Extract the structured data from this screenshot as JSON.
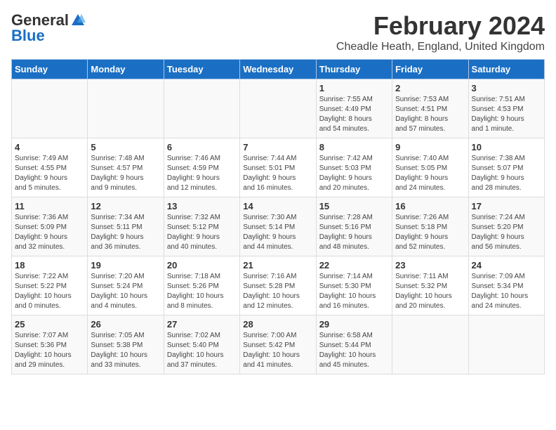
{
  "logo": {
    "general": "General",
    "blue": "Blue"
  },
  "header": {
    "month": "February 2024",
    "location": "Cheadle Heath, England, United Kingdom"
  },
  "weekdays": [
    "Sunday",
    "Monday",
    "Tuesday",
    "Wednesday",
    "Thursday",
    "Friday",
    "Saturday"
  ],
  "weeks": [
    [
      {
        "day": "",
        "info": ""
      },
      {
        "day": "",
        "info": ""
      },
      {
        "day": "",
        "info": ""
      },
      {
        "day": "",
        "info": ""
      },
      {
        "day": "1",
        "info": "Sunrise: 7:55 AM\nSunset: 4:49 PM\nDaylight: 8 hours\nand 54 minutes."
      },
      {
        "day": "2",
        "info": "Sunrise: 7:53 AM\nSunset: 4:51 PM\nDaylight: 8 hours\nand 57 minutes."
      },
      {
        "day": "3",
        "info": "Sunrise: 7:51 AM\nSunset: 4:53 PM\nDaylight: 9 hours\nand 1 minute."
      }
    ],
    [
      {
        "day": "4",
        "info": "Sunrise: 7:49 AM\nSunset: 4:55 PM\nDaylight: 9 hours\nand 5 minutes."
      },
      {
        "day": "5",
        "info": "Sunrise: 7:48 AM\nSunset: 4:57 PM\nDaylight: 9 hours\nand 9 minutes."
      },
      {
        "day": "6",
        "info": "Sunrise: 7:46 AM\nSunset: 4:59 PM\nDaylight: 9 hours\nand 12 minutes."
      },
      {
        "day": "7",
        "info": "Sunrise: 7:44 AM\nSunset: 5:01 PM\nDaylight: 9 hours\nand 16 minutes."
      },
      {
        "day": "8",
        "info": "Sunrise: 7:42 AM\nSunset: 5:03 PM\nDaylight: 9 hours\nand 20 minutes."
      },
      {
        "day": "9",
        "info": "Sunrise: 7:40 AM\nSunset: 5:05 PM\nDaylight: 9 hours\nand 24 minutes."
      },
      {
        "day": "10",
        "info": "Sunrise: 7:38 AM\nSunset: 5:07 PM\nDaylight: 9 hours\nand 28 minutes."
      }
    ],
    [
      {
        "day": "11",
        "info": "Sunrise: 7:36 AM\nSunset: 5:09 PM\nDaylight: 9 hours\nand 32 minutes."
      },
      {
        "day": "12",
        "info": "Sunrise: 7:34 AM\nSunset: 5:11 PM\nDaylight: 9 hours\nand 36 minutes."
      },
      {
        "day": "13",
        "info": "Sunrise: 7:32 AM\nSunset: 5:12 PM\nDaylight: 9 hours\nand 40 minutes."
      },
      {
        "day": "14",
        "info": "Sunrise: 7:30 AM\nSunset: 5:14 PM\nDaylight: 9 hours\nand 44 minutes."
      },
      {
        "day": "15",
        "info": "Sunrise: 7:28 AM\nSunset: 5:16 PM\nDaylight: 9 hours\nand 48 minutes."
      },
      {
        "day": "16",
        "info": "Sunrise: 7:26 AM\nSunset: 5:18 PM\nDaylight: 9 hours\nand 52 minutes."
      },
      {
        "day": "17",
        "info": "Sunrise: 7:24 AM\nSunset: 5:20 PM\nDaylight: 9 hours\nand 56 minutes."
      }
    ],
    [
      {
        "day": "18",
        "info": "Sunrise: 7:22 AM\nSunset: 5:22 PM\nDaylight: 10 hours\nand 0 minutes."
      },
      {
        "day": "19",
        "info": "Sunrise: 7:20 AM\nSunset: 5:24 PM\nDaylight: 10 hours\nand 4 minutes."
      },
      {
        "day": "20",
        "info": "Sunrise: 7:18 AM\nSunset: 5:26 PM\nDaylight: 10 hours\nand 8 minutes."
      },
      {
        "day": "21",
        "info": "Sunrise: 7:16 AM\nSunset: 5:28 PM\nDaylight: 10 hours\nand 12 minutes."
      },
      {
        "day": "22",
        "info": "Sunrise: 7:14 AM\nSunset: 5:30 PM\nDaylight: 10 hours\nand 16 minutes."
      },
      {
        "day": "23",
        "info": "Sunrise: 7:11 AM\nSunset: 5:32 PM\nDaylight: 10 hours\nand 20 minutes."
      },
      {
        "day": "24",
        "info": "Sunrise: 7:09 AM\nSunset: 5:34 PM\nDaylight: 10 hours\nand 24 minutes."
      }
    ],
    [
      {
        "day": "25",
        "info": "Sunrise: 7:07 AM\nSunset: 5:36 PM\nDaylight: 10 hours\nand 29 minutes."
      },
      {
        "day": "26",
        "info": "Sunrise: 7:05 AM\nSunset: 5:38 PM\nDaylight: 10 hours\nand 33 minutes."
      },
      {
        "day": "27",
        "info": "Sunrise: 7:02 AM\nSunset: 5:40 PM\nDaylight: 10 hours\nand 37 minutes."
      },
      {
        "day": "28",
        "info": "Sunrise: 7:00 AM\nSunset: 5:42 PM\nDaylight: 10 hours\nand 41 minutes."
      },
      {
        "day": "29",
        "info": "Sunrise: 6:58 AM\nSunset: 5:44 PM\nDaylight: 10 hours\nand 45 minutes."
      },
      {
        "day": "",
        "info": ""
      },
      {
        "day": "",
        "info": ""
      }
    ]
  ]
}
